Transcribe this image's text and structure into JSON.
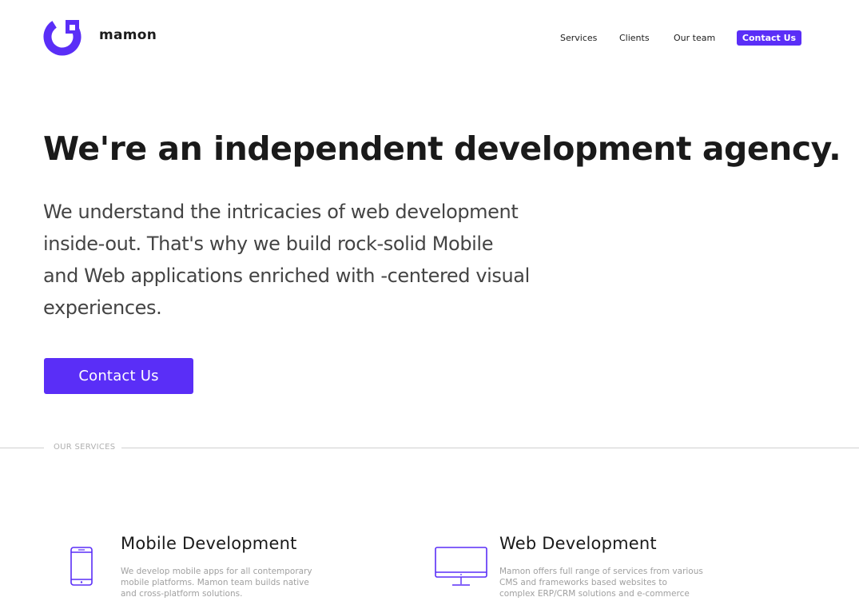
{
  "header": {
    "logo_text": "mamon",
    "nav": {
      "services": "Services",
      "clients": "Clients",
      "team": "Our team",
      "contact": "Contact Us"
    }
  },
  "hero": {
    "title": "We're an independent development agency.",
    "text": "We understand the intricacies of web development inside-out. That's why we build rock-solid Mobile and Web applications enriched with -centered visual experiences.",
    "cta": "Contact Us"
  },
  "services_section": {
    "label": "OUR SERVICES",
    "items": [
      {
        "title": "Mobile Development",
        "description": "We develop mobile apps for all contemporary mobile platforms. Mamon team builds native and cross-platform solutions.",
        "icon": "mobile-phone-icon"
      },
      {
        "title": "Web Development",
        "description": "Mamon offers full range of services from various CMS and frameworks based websites to complex ERP/CRM solutions and e-commerce stores.",
        "icon": "desktop-monitor-icon"
      }
    ]
  },
  "colors": {
    "accent": "#5a2ef7",
    "text_dark": "#1a1a1a",
    "text_muted": "#a0a0a0"
  }
}
